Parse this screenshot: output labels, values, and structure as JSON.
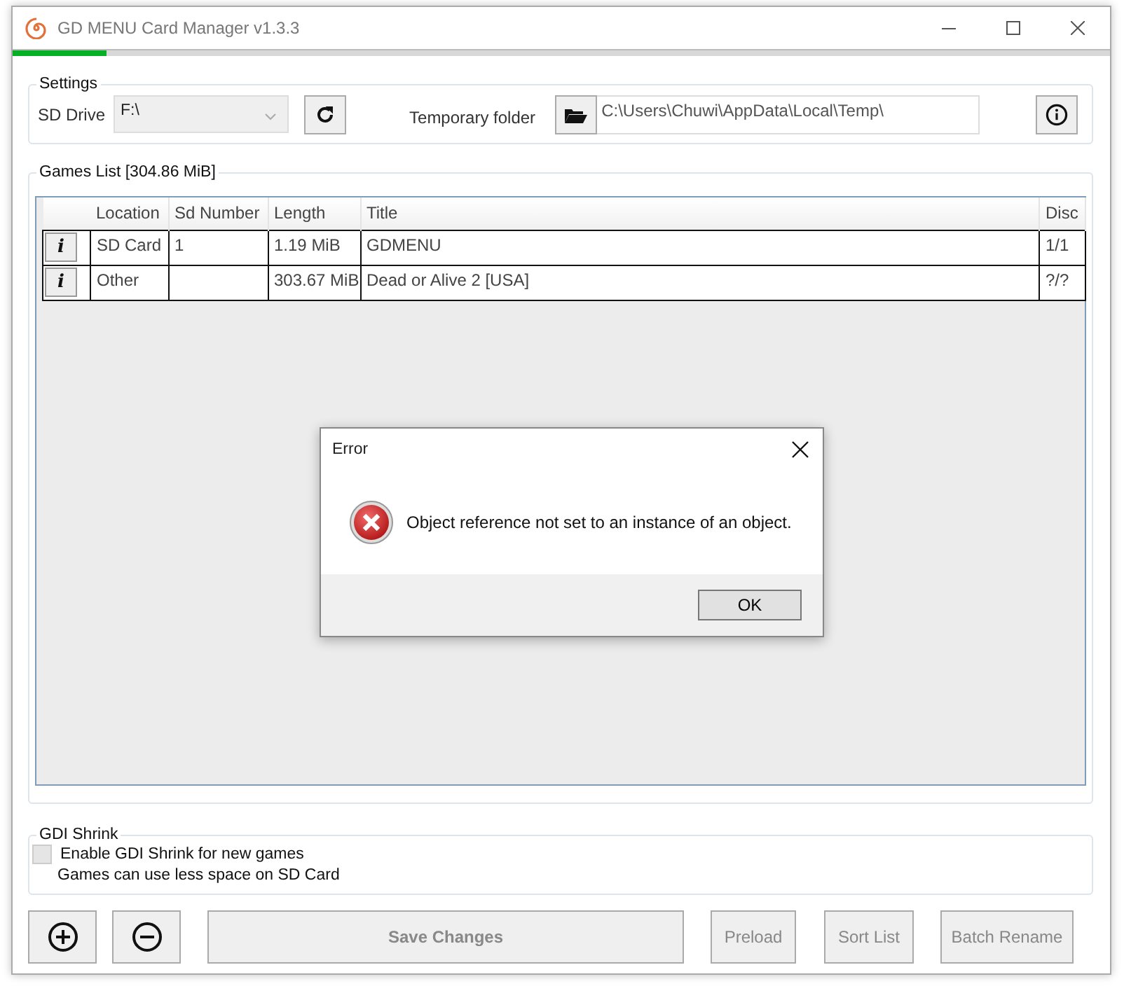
{
  "window": {
    "title": "GD MENU Card Manager v1.3.3"
  },
  "progress": {
    "level": 0.086
  },
  "settings": {
    "legend": "Settings",
    "sd_drive_label": "SD Drive",
    "sd_drive_value": "F:\\",
    "temp_label": "Temporary folder",
    "temp_path": "C:\\Users\\Chuwi\\AppData\\Local\\Temp\\"
  },
  "games_list": {
    "legend": "Games List [304.86 MiB]",
    "columns": [
      "Location",
      "Sd Number",
      "Length",
      "Title",
      "Disc"
    ],
    "rows": [
      {
        "info": "i",
        "location": "SD Card",
        "sd_number": "1",
        "length": "1.19 MiB",
        "title": "GDMENU",
        "disc": "1/1"
      },
      {
        "info": "i",
        "location": "Other",
        "sd_number": "",
        "length": "303.67 MiB",
        "title": "Dead or Alive 2 [USA]",
        "disc": "?/?"
      }
    ]
  },
  "gdi_shrink": {
    "legend": "GDI Shrink",
    "label": "Enable GDI Shrink for new games",
    "checked": false,
    "note": "Games can use less space on SD Card"
  },
  "buttons": [
    {
      "kind": "add",
      "disabled": false
    },
    {
      "kind": "remove",
      "disabled": false
    },
    {
      "kind": "text",
      "label": "Save Changes",
      "disabled": true
    },
    {
      "kind": "text",
      "label": "Preload",
      "disabled": true
    },
    {
      "kind": "text",
      "label": "Sort List",
      "disabled": true
    },
    {
      "kind": "text",
      "label": "Batch Rename",
      "disabled": true
    }
  ],
  "dialog": {
    "title": "Error",
    "message": "Object reference not set to an instance of an object.",
    "button": "OK"
  }
}
